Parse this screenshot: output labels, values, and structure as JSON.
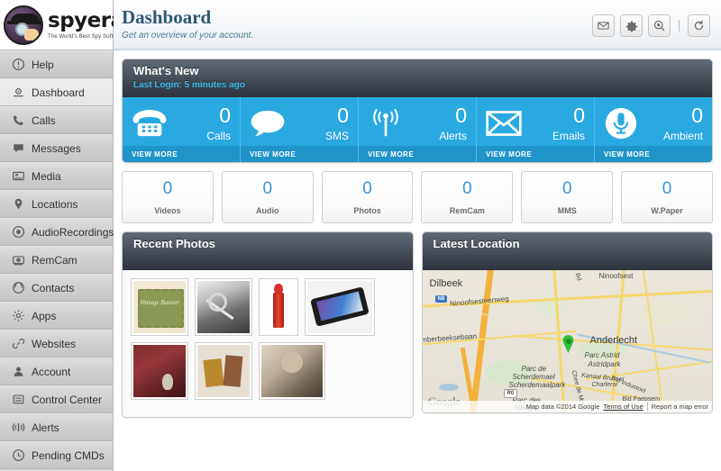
{
  "brand": {
    "name": "spyera",
    "tagline": "The World's Best Spy Software",
    "logo_icon": "spy-detective-icon"
  },
  "sidebar": {
    "items": [
      {
        "label": "Help",
        "icon": "help-circle-icon",
        "active": false
      },
      {
        "label": "Dashboard",
        "icon": "dashboard-icon",
        "active": true
      },
      {
        "label": "Calls",
        "icon": "phone-icon",
        "active": false
      },
      {
        "label": "Messages",
        "icon": "chat-bubble-icon",
        "active": false
      },
      {
        "label": "Media",
        "icon": "image-icon",
        "active": false
      },
      {
        "label": "Locations",
        "icon": "map-pin-icon",
        "active": false
      },
      {
        "label": "AudioRecordings",
        "icon": "audio-disc-icon",
        "active": false
      },
      {
        "label": "RemCam",
        "icon": "camera-icon",
        "active": false
      },
      {
        "label": "Contacts",
        "icon": "contacts-icon",
        "active": false
      },
      {
        "label": "Apps",
        "icon": "apps-gear-icon",
        "active": false
      },
      {
        "label": "Websites",
        "icon": "link-icon",
        "active": false
      },
      {
        "label": "Account",
        "icon": "user-icon",
        "active": false
      },
      {
        "label": "Control Center",
        "icon": "sliders-icon",
        "active": false
      },
      {
        "label": "Alerts",
        "icon": "signal-alert-icon",
        "active": false
      },
      {
        "label": "Pending CMDs",
        "icon": "clock-icon",
        "active": false
      }
    ]
  },
  "header": {
    "title": "Dashboard",
    "subtitle": "Get an overview of your account.",
    "tools": [
      {
        "name": "mail-icon",
        "glyph": "✉"
      },
      {
        "name": "gear-icon",
        "glyph": "⚙"
      },
      {
        "name": "search-icon",
        "glyph": "◉"
      },
      {
        "name": "refresh-icon",
        "glyph": "↻"
      }
    ]
  },
  "whats_new": {
    "title": "What's New",
    "last_login": "Last Login: 5 minutes ago",
    "view_more_label": "VIEW MORE",
    "accent_color": "#29a9e0",
    "tiles": [
      {
        "count": "0",
        "label": "Calls",
        "icon": "telephone-icon",
        "has_view_more": true
      },
      {
        "count": "0",
        "label": "SMS",
        "icon": "speech-bubble-icon",
        "has_view_more": true
      },
      {
        "count": "0",
        "label": "Alerts",
        "icon": "antenna-signal-icon",
        "has_view_more": true
      },
      {
        "count": "0",
        "label": "Emails",
        "icon": "envelope-icon",
        "has_view_more": true
      },
      {
        "count": "0",
        "label": "Ambient",
        "icon": "microphone-icon",
        "has_view_more": true
      }
    ]
  },
  "stats": [
    {
      "count": "0",
      "label": "Videos"
    },
    {
      "count": "0",
      "label": "Audio"
    },
    {
      "count": "0",
      "label": "Photos"
    },
    {
      "count": "0",
      "label": "RemCam"
    },
    {
      "count": "0",
      "label": "MMS"
    },
    {
      "count": "0",
      "label": "W.Paper"
    }
  ],
  "recent_photos": {
    "title": "Recent Photos",
    "thumbnails": [
      {
        "name": "vintage-banner-thumbnail",
        "caption": "Vintage Banner"
      },
      {
        "name": "black-white-tools-thumbnail",
        "caption": ""
      },
      {
        "name": "red-gas-pump-thumbnail",
        "caption": ""
      },
      {
        "name": "tablet-device-thumbnail",
        "caption": ""
      },
      {
        "name": "leather-bag-thumbnail",
        "caption": ""
      },
      {
        "name": "vintage-collage-thumbnail",
        "caption": ""
      },
      {
        "name": "vintage-portrait-thumbnail",
        "caption": ""
      }
    ]
  },
  "latest_location": {
    "title": "Latest Location",
    "map_labels": [
      {
        "text": "Dilbeek",
        "size": "big"
      },
      {
        "text": "Anderlecht",
        "size": "big"
      },
      {
        "text": "Ninoofsesteenweg",
        "size": "small"
      },
      {
        "text": "Ninoofsest",
        "size": "small"
      },
      {
        "text": "Imberbeeksebaan",
        "size": "small"
      },
      {
        "text": "Parc Astrid",
        "size": "small"
      },
      {
        "text": "Astridpark",
        "size": "small"
      },
      {
        "text": "Parc de",
        "size": "small"
      },
      {
        "text": "Scherdemael",
        "size": "small"
      },
      {
        "text": "Scherdemaalpark",
        "size": "small"
      },
      {
        "text": "Kanaal Brussel",
        "size": "small"
      },
      {
        "text": "Charleroi",
        "size": "small"
      },
      {
        "text": "Parc des",
        "size": "small"
      },
      {
        "text": "étangs",
        "size": "small"
      },
      {
        "text": "Bld Industriel",
        "size": "small"
      },
      {
        "text": "Bld Paepsem",
        "size": "small"
      },
      {
        "text": "Chee de Mons",
        "size": "small"
      },
      {
        "text": "Bd",
        "size": "small"
      }
    ],
    "shields": [
      "N8",
      "R0"
    ],
    "marker": "location-pin-marker",
    "watermark": "Google",
    "attribution": "Map data ©2014 Google",
    "terms_label": "Terms of Use",
    "report_label": "Report a map error"
  }
}
